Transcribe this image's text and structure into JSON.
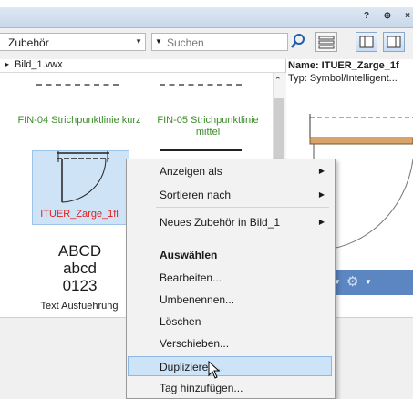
{
  "titlebar": {
    "help_label": "?",
    "pin_label": "⊕",
    "close_label": "×"
  },
  "toolbar": {
    "category_value": "Zubehör",
    "search_placeholder": "Suchen"
  },
  "left_panel": {
    "path": "Bild_1.vwx",
    "items": [
      {
        "label": "FIN-04 Strichpunktlinie kurz",
        "color": "#3d8c2a"
      },
      {
        "label": "FIN-05 Strichpunktlinie mittel",
        "color": "#3d8c2a"
      },
      {
        "label": "ITUER_Zarge_1fl",
        "color": "#e02020"
      },
      {
        "label": "Text Ausfuehrung",
        "color": "#1a1a1a"
      }
    ],
    "text_sample": [
      "ABCD",
      "abcd",
      "0123"
    ]
  },
  "right_panel": {
    "name_line": "Name: ITUER_Zarge_1f",
    "type_line": "Typ: Symbol/Intelligent..."
  },
  "context_menu": {
    "items": [
      {
        "label": "Anzeigen als",
        "submenu": true
      },
      {
        "label": "Sortieren nach",
        "submenu": true
      },
      {
        "label": "Neues Zubehör in Bild_1",
        "submenu": true
      },
      {
        "label": "Auswählen",
        "bold": true
      },
      {
        "label": "Bearbeiten..."
      },
      {
        "label": "Umbenennen..."
      },
      {
        "label": "Löschen"
      },
      {
        "label": "Verschieben..."
      },
      {
        "label": "Duplizieren...",
        "highlighted": true
      },
      {
        "label": "Tag hinzufügen..."
      }
    ]
  },
  "colors": {
    "accent": "#5b86c2",
    "highlight": "#cde3f7",
    "green_label": "#3d8c2a",
    "red_label": "#e02020"
  }
}
